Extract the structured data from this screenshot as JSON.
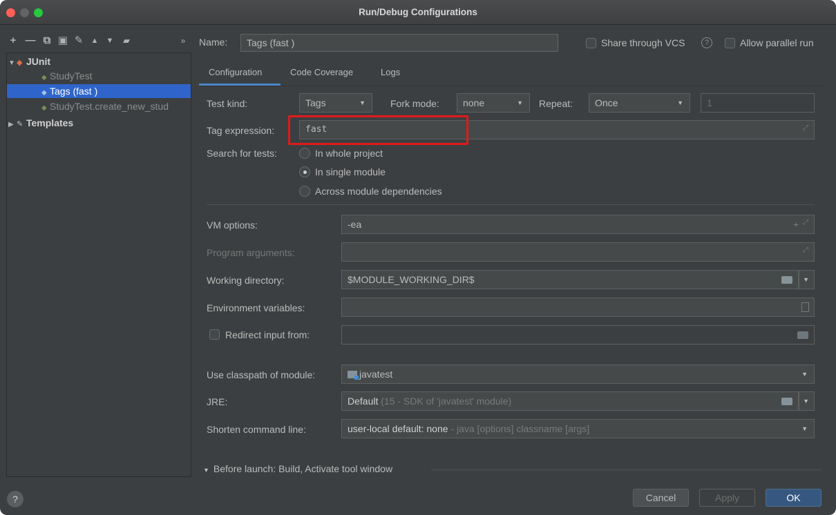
{
  "window": {
    "title": "Run/Debug Configurations"
  },
  "toolbar": {
    "icons": [
      "add-icon",
      "remove-icon",
      "copy-icon",
      "save-icon",
      "wrench-icon",
      "move-up-icon",
      "move-down-icon",
      "folder-icon",
      "more-icon"
    ],
    "add_glyph": "+",
    "remove_glyph": "—",
    "copy_glyph": "⧉",
    "save_glyph": "▣",
    "wrench_glyph": "✎",
    "up_glyph": "▲",
    "down_glyph": "▼",
    "folder_glyph": "▰",
    "more_glyph": "»"
  },
  "tree": {
    "items": [
      {
        "label": "JUnit"
      },
      {
        "label": "StudyTest"
      },
      {
        "label": "Tags (fast )"
      },
      {
        "label": "StudyTest.create_new_stud"
      },
      {
        "label": "Templates"
      }
    ]
  },
  "header": {
    "name_label": "Name:",
    "name_value": "Tags (fast )",
    "share_label": "Share through VCS",
    "parallel_label": "Allow parallel run"
  },
  "tabs": [
    {
      "label": "Configuration"
    },
    {
      "label": "Code Coverage"
    },
    {
      "label": "Logs"
    }
  ],
  "form": {
    "test_kind_label": "Test kind:",
    "test_kind_value": "Tags",
    "fork_mode_label": "Fork mode:",
    "fork_mode_value": "none",
    "repeat_label": "Repeat:",
    "repeat_value": "Once",
    "repeat_count": "1",
    "tag_expression_label": "Tag expression:",
    "tag_expression_value": "fast",
    "search_label": "Search for tests:",
    "search_options": [
      {
        "label": "In whole project",
        "selected": false
      },
      {
        "label": "In single module",
        "selected": true
      },
      {
        "label": "Across module dependencies",
        "selected": false
      }
    ],
    "vm_options_label": "VM options:",
    "vm_options_value": "-ea",
    "program_args_label": "Program arguments:",
    "program_args_value": "",
    "working_dir_label": "Working directory:",
    "working_dir_value": "$MODULE_WORKING_DIR$",
    "env_vars_label": "Environment variables:",
    "env_vars_value": "",
    "redirect_label": "Redirect input from:",
    "classpath_label": "Use classpath of module:",
    "classpath_value": "javatest",
    "jre_label": "JRE:",
    "jre_value_bold": "Default",
    "jre_value_rest": "(15 - SDK of 'javatest' module)",
    "shorten_label": "Shorten command line:",
    "shorten_value_main": "user-local default: none",
    "shorten_value_rest": "- java [options] classname [args]"
  },
  "before_launch": {
    "label": "Before launch: Build, Activate tool window"
  },
  "buttons": {
    "help": "?",
    "cancel": "Cancel",
    "apply": "Apply",
    "ok": "OK"
  },
  "colors": {
    "accent": "#2f65ca",
    "highlight_box": "#e01a1a",
    "ok_button": "#365880"
  }
}
